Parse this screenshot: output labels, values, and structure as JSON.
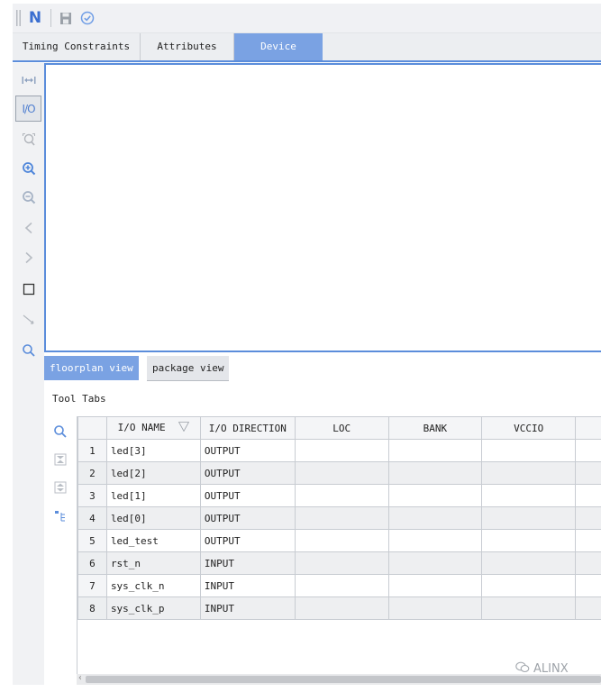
{
  "toolbar": {
    "items": [
      {
        "name": "grip-icon"
      },
      {
        "name": "n-logo-icon",
        "text": "N"
      },
      {
        "name": "save-icon"
      },
      {
        "name": "check-circle-icon"
      }
    ]
  },
  "tabs": [
    {
      "label": "Timing Constraints",
      "active": false
    },
    {
      "label": "Attributes",
      "active": false
    },
    {
      "label": "Device",
      "active": true
    }
  ],
  "left_toolbar": {
    "io_label": "I/O",
    "buttons": [
      "fit-width-icon",
      "io-icon",
      "zoom-area-icon",
      "zoom-in-icon",
      "zoom-out-icon",
      "back-arrow-icon",
      "forward-arrow-icon",
      "rectangle-select-icon",
      "line-tool-icon",
      "search-icon"
    ]
  },
  "view_tabs": [
    {
      "label": "floorplan view",
      "active": true
    },
    {
      "label": "package view",
      "active": false
    }
  ],
  "tool_tabs_label": "Tool Tabs",
  "table": {
    "columns": [
      "I/O NAME",
      "I/O DIRECTION",
      "LOC",
      "BANK",
      "VCCIO"
    ],
    "rows": [
      {
        "num": "1",
        "name": "led[3]",
        "direction": "OUTPUT"
      },
      {
        "num": "2",
        "name": "led[2]",
        "direction": "OUTPUT"
      },
      {
        "num": "3",
        "name": "led[1]",
        "direction": "OUTPUT"
      },
      {
        "num": "4",
        "name": "led[0]",
        "direction": "OUTPUT"
      },
      {
        "num": "5",
        "name": "led_test",
        "direction": "OUTPUT"
      },
      {
        "num": "6",
        "name": "rst_n",
        "direction": "INPUT"
      },
      {
        "num": "7",
        "name": "sys_clk_n",
        "direction": "INPUT"
      },
      {
        "num": "8",
        "name": "sys_clk_p",
        "direction": "INPUT"
      }
    ]
  },
  "watermark": "ALINX",
  "colors": {
    "accent": "#5b8ddb",
    "active_tab": "#7aa2e3"
  }
}
